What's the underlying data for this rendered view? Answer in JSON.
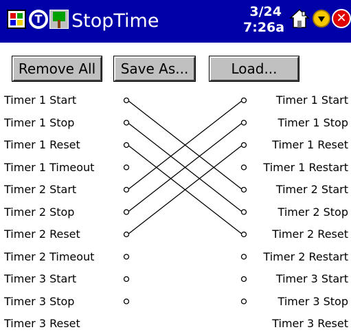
{
  "titlebar": {
    "app_title": "StopTime",
    "clock_date": "3/24",
    "clock_time": "7:26a",
    "close_glyph": "✕",
    "icons": [
      "windows-flag-icon",
      "t-icon",
      "tree-icon",
      "home-icon",
      "dropdown-icon",
      "close-icon"
    ]
  },
  "toolbar": {
    "remove_all": "Remove All",
    "save_as": "Save As...",
    "load": "Load..."
  },
  "left_events": [
    "Timer 1 Start",
    "Timer 1 Stop",
    "Timer 1 Reset",
    "Timer 1 Timeout",
    "Timer 2 Start",
    "Timer 2 Stop",
    "Timer 2 Reset",
    "Timer 2 Timeout",
    "Timer 3 Start",
    "Timer 3 Stop",
    "Timer 3 Reset"
  ],
  "right_actions": [
    "Timer 1 Start",
    "Timer 1 Stop",
    "Timer 1 Reset",
    "Timer 1 Restart",
    "Timer 2 Start",
    "Timer 2 Stop",
    "Timer 2 Reset",
    "Timer 2 Restart",
    "Timer 3 Start",
    "Timer 3 Stop",
    "Timer 3 Reset"
  ],
  "connections": [
    [
      0,
      4
    ],
    [
      1,
      5
    ],
    [
      2,
      6
    ],
    [
      4,
      0
    ],
    [
      5,
      1
    ],
    [
      6,
      2
    ]
  ],
  "colors": {
    "titlebar": "#0000a8",
    "button_face": "#c0c0c0"
  }
}
